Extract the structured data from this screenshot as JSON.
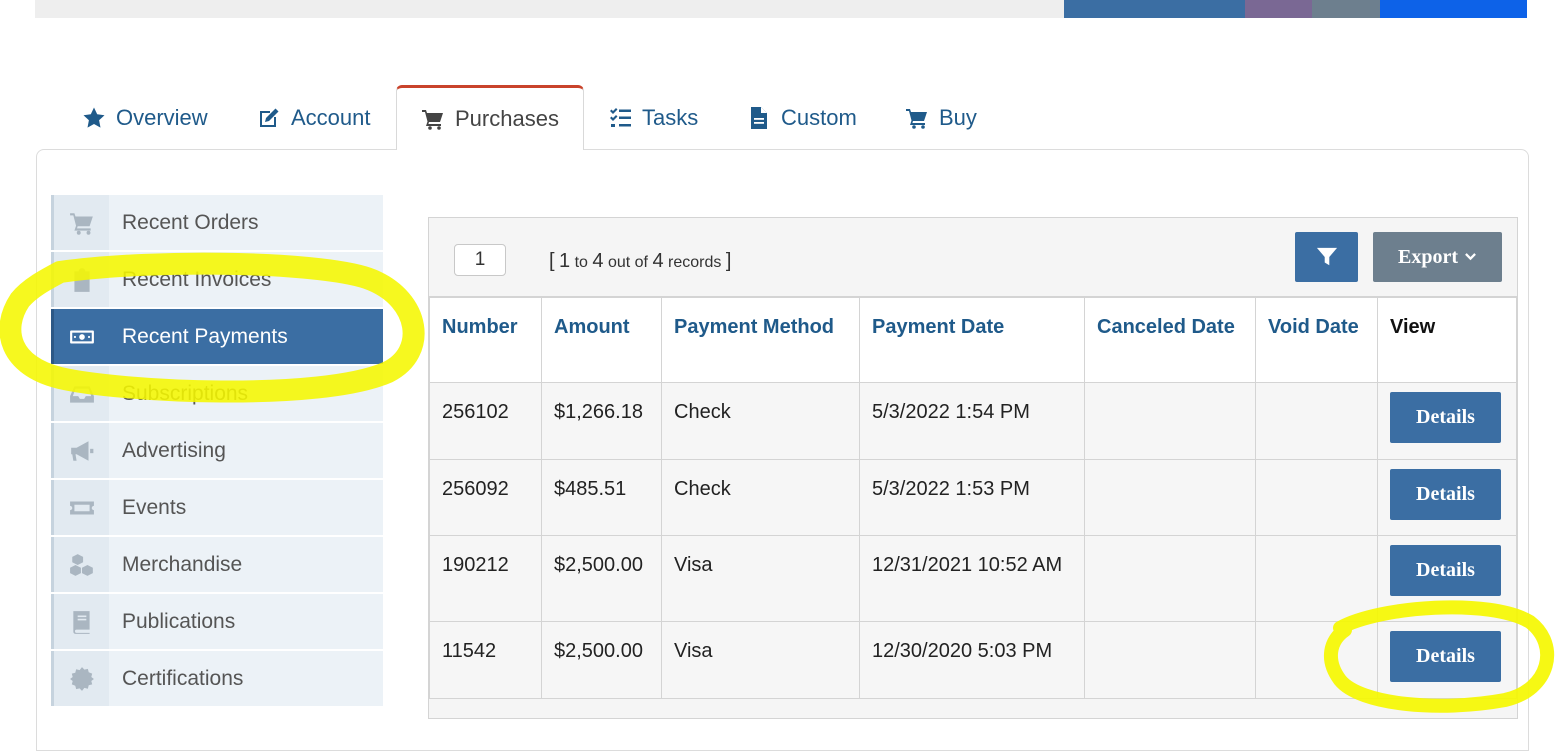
{
  "tabs": [
    {
      "label": "Overview",
      "icon": "star-icon"
    },
    {
      "label": "Account",
      "icon": "edit-icon"
    },
    {
      "label": "Purchases",
      "icon": "cart-icon",
      "active": true
    },
    {
      "label": "Tasks",
      "icon": "list-check-icon"
    },
    {
      "label": "Custom",
      "icon": "file-icon"
    },
    {
      "label": "Buy",
      "icon": "cart-icon"
    }
  ],
  "sidebar": {
    "items": [
      {
        "label": "Recent Orders",
        "icon": "cart-icon"
      },
      {
        "label": "Recent Invoices",
        "icon": "clipboard-icon"
      },
      {
        "label": "Recent Payments",
        "icon": "money-icon",
        "active": true
      },
      {
        "label": "Subscriptions",
        "icon": "inbox-icon"
      },
      {
        "label": "Advertising",
        "icon": "megaphone-icon"
      },
      {
        "label": "Events",
        "icon": "ticket-icon"
      },
      {
        "label": "Merchandise",
        "icon": "boxes-icon"
      },
      {
        "label": "Publications",
        "icon": "book-icon"
      },
      {
        "label": "Certifications",
        "icon": "certificate-icon"
      }
    ]
  },
  "grid": {
    "page": "1",
    "records": {
      "open": "[",
      "from": "1",
      "to_word": "to",
      "to": "4",
      "out_of": "out of",
      "total": "4",
      "records_word": "records",
      "close": "]"
    },
    "export_label": "Export",
    "columns": [
      "Number",
      "Amount",
      "Payment Method",
      "Payment Date",
      "Canceled Date",
      "Void Date",
      "View"
    ],
    "rows": [
      {
        "number": "256102",
        "amount": "$1,266.18",
        "method": "Check",
        "date": "5/3/2022 1:54 PM",
        "canceled": "",
        "void": "",
        "action": "Details"
      },
      {
        "number": "256092",
        "amount": "$485.51",
        "method": "Check",
        "date": "5/3/2022 1:53 PM",
        "canceled": "",
        "void": "",
        "action": "Details"
      },
      {
        "number": "190212",
        "amount": "$2,500.00",
        "method": "Visa",
        "date": "12/31/2021 10:52 AM",
        "canceled": "",
        "void": "",
        "action": "Details"
      },
      {
        "number": "11542",
        "amount": "$2,500.00",
        "method": "Visa",
        "date": "12/30/2020 5:03 PM",
        "canceled": "",
        "void": "",
        "action": "Details"
      }
    ]
  },
  "colors": {
    "primary": "#3b6ea3",
    "link": "#1f5a8a",
    "tab_accent": "#c9432b",
    "export": "#6d7f8e",
    "highlighter": "#f5f700"
  }
}
